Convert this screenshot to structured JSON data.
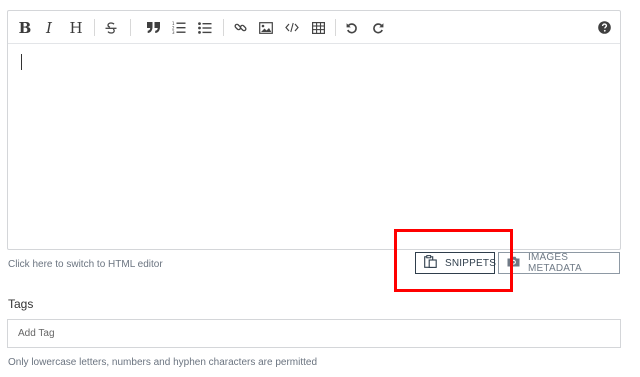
{
  "editor": {
    "toolbar": {
      "bold": "B",
      "italic": "I",
      "heading": "H",
      "icons": [
        "bold-icon",
        "italic-icon",
        "heading-icon",
        "strikethrough-icon",
        "quote-icon",
        "ordered-list-icon",
        "unordered-list-icon",
        "link-icon",
        "image-icon",
        "code-icon",
        "table-icon",
        "undo-icon",
        "redo-icon",
        "help-icon"
      ]
    },
    "content": ""
  },
  "switch_link": "Click here to switch to HTML editor",
  "buttons": {
    "snippets": "SNIPPETS",
    "images_metadata": "IMAGES METADATA"
  },
  "tags": {
    "label": "Tags",
    "placeholder": "Add Tag",
    "hint": "Only lowercase letters, numbers and hyphen characters are permitted"
  },
  "colors": {
    "highlight": "#ff0000",
    "button_border": "#2f3e4c",
    "muted_text": "#6b7480"
  }
}
